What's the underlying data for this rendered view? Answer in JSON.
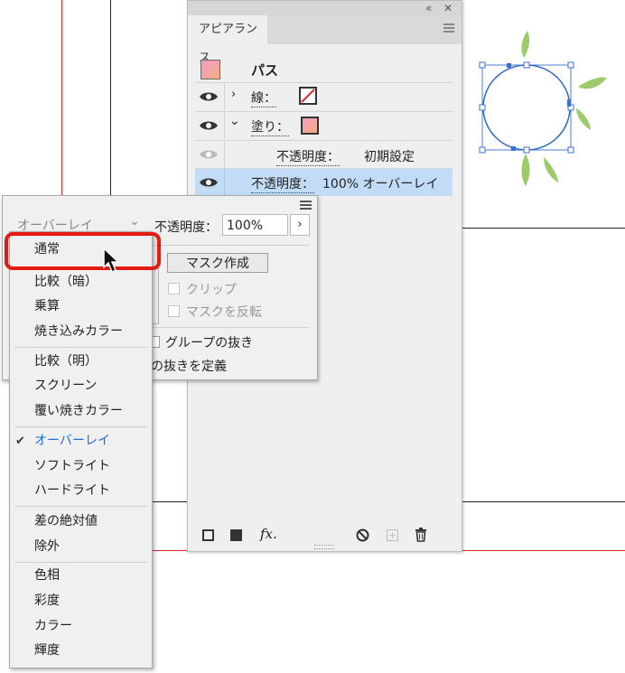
{
  "colors": {
    "accent_blue": "#1e6fd9",
    "selected_row": "#c2dcf5",
    "highlight_red": "#e41b13",
    "guide_red": "#d9232a",
    "leaf_green": "#8dc45a"
  },
  "appearance_panel": {
    "tab_label": "アピアランス",
    "object_label": "パス",
    "stroke": {
      "label": "線："
    },
    "fill": {
      "label": "塗り："
    },
    "fill_opacity": {
      "label": "不透明度：",
      "value": "初期設定"
    },
    "object_opacity": {
      "label": "不透明度：",
      "value": "100% オーバーレイ"
    },
    "bottom_tools": {
      "fx_label": "fx."
    }
  },
  "transparency_panel": {
    "blend_mode_value": "オーバーレイ",
    "opacity_label": "不透明度：",
    "opacity_value": "100%",
    "make_mask_button": "マスク作成",
    "clip_label": "クリップ",
    "invert_mask_label": "マスクを反転",
    "knockout_group_label": "グループの抜き",
    "define_knockout_label": "の抜きを定義"
  },
  "blend_mode_menu": {
    "selected": "オーバーレイ",
    "items": [
      "通常",
      "比較（暗）",
      "乗算",
      "焼き込みカラー",
      "比較（明）",
      "スクリーン",
      "覆い焼きカラー",
      "オーバーレイ",
      "ソフトライト",
      "ハードライト",
      "差の絶対値",
      "除外",
      "色相",
      "彩度",
      "カラー",
      "輝度"
    ]
  }
}
